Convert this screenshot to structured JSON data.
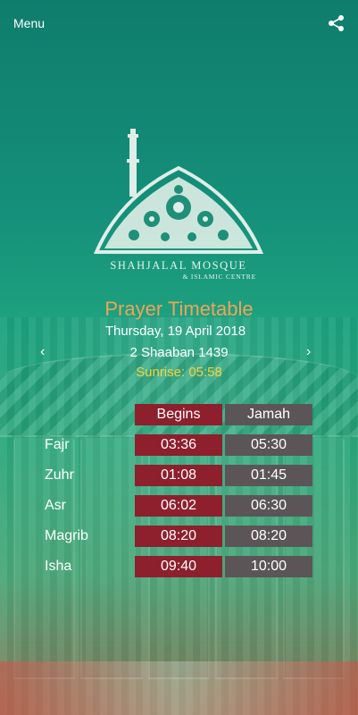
{
  "topbar": {
    "menu_label": "Menu",
    "share_icon": "share-icon"
  },
  "logo": {
    "title": "SHAHJALAL MOSQUE",
    "subtitle": "& ISLAMIC CENTRE"
  },
  "header": {
    "title": "Prayer Timetable",
    "date": "Thursday, 19 April 2018",
    "hijri": "2 Shaaban 1439",
    "sunrise": "Sunrise: 05:58"
  },
  "nav": {
    "prev_icon": "chevron-left-icon",
    "next_icon": "chevron-right-icon",
    "prev_glyph": "‹",
    "next_glyph": "›"
  },
  "table": {
    "col_begins": "Begins",
    "col_jamah": "Jamah",
    "rows": [
      {
        "name": "Fajr",
        "begins": "03:36",
        "jamah": "05:30"
      },
      {
        "name": "Zuhr",
        "begins": "01:08",
        "jamah": "01:45"
      },
      {
        "name": "Asr",
        "begins": "06:02",
        "jamah": "06:30"
      },
      {
        "name": "Magrib",
        "begins": "08:20",
        "jamah": "08:20"
      },
      {
        "name": "Isha",
        "begins": "09:40",
        "jamah": "10:00"
      }
    ]
  },
  "colors": {
    "title": "#f0a35b",
    "sunrise": "#f7d33a",
    "begins": "#8e1f2d",
    "jamah": "#5c5557"
  }
}
